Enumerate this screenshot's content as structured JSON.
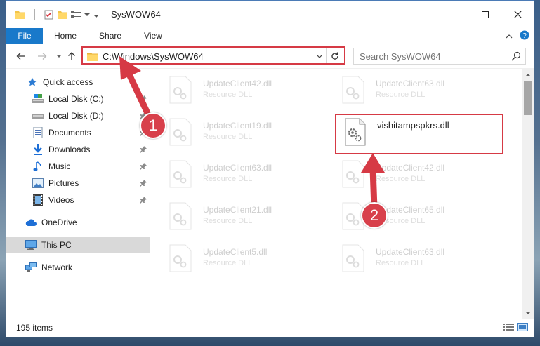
{
  "window": {
    "title": "SysWOW64"
  },
  "ribbon": {
    "file": "File",
    "tabs": [
      "Home",
      "Share",
      "View"
    ]
  },
  "address": {
    "path": "C:\\Windows\\SysWOW64"
  },
  "search": {
    "placeholder": "Search SysWOW64"
  },
  "navpane": {
    "items": [
      {
        "label": "Quick access",
        "icon": "star-icon",
        "pinned": false
      },
      {
        "label": "Local Disk (C:)",
        "icon": "drive-icon",
        "pinned": true
      },
      {
        "label": "Local Disk (D:)",
        "icon": "drive-icon",
        "pinned": true
      },
      {
        "label": "Documents",
        "icon": "documents-icon",
        "pinned": true
      },
      {
        "label": "Downloads",
        "icon": "download-icon",
        "pinned": true
      },
      {
        "label": "Music",
        "icon": "music-icon",
        "pinned": true
      },
      {
        "label": "Pictures",
        "icon": "pictures-icon",
        "pinned": true
      },
      {
        "label": "Videos",
        "icon": "videos-icon",
        "pinned": true
      },
      {
        "label": "OneDrive",
        "icon": "cloud-icon",
        "pinned": false
      },
      {
        "label": "This PC",
        "icon": "computer-icon",
        "pinned": false,
        "selected": true
      },
      {
        "label": "Network",
        "icon": "network-icon",
        "pinned": false
      }
    ]
  },
  "files": {
    "col1": [
      {
        "name": "UpdateClient42.dll",
        "type": "Resource DLL"
      },
      {
        "name": "UpdateClient19.dll",
        "type": "Resource DLL"
      },
      {
        "name": "UpdateClient63.dll",
        "type": "Resource DLL"
      },
      {
        "name": "UpdateClient21.dll",
        "type": "Resource DLL"
      },
      {
        "name": "UpdateClient5.dll",
        "type": "Resource DLL"
      }
    ],
    "col2": [
      {
        "name": "UpdateClient63.dll",
        "type": "Resource DLL"
      },
      {
        "name": "vishitampspkrs.dll",
        "type": ""
      },
      {
        "name": "UpdateClient42.dll",
        "type": "Resource DLL"
      },
      {
        "name": "UpdateClient65.dll",
        "type": "Resource DLL"
      },
      {
        "name": "UpdateClient63.dll",
        "type": "Resource DLL"
      }
    ]
  },
  "status": {
    "count": "195 items"
  },
  "annotations": {
    "badge1": "1",
    "badge2": "2"
  },
  "colors": {
    "accent": "#1979ca",
    "annotation": "#d63a45"
  }
}
